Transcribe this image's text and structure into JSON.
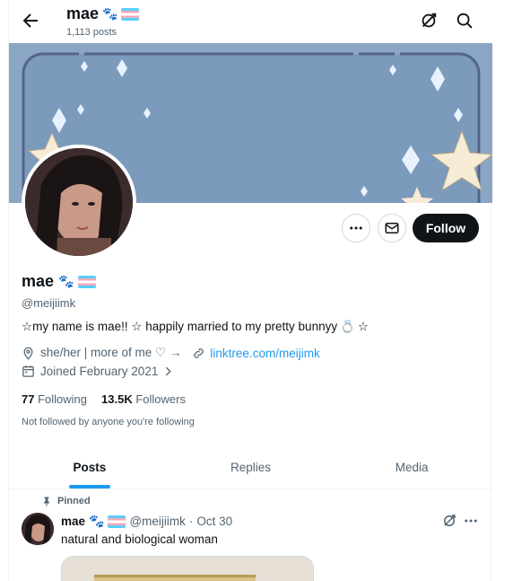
{
  "header": {
    "display_name": "mae",
    "post_count": "1,113 posts",
    "paw_emoji": "🐾"
  },
  "profile": {
    "display_name": "mae",
    "handle": "@meijiimk",
    "bio": "☆my name is mae!! ☆ happily married to my pretty bunnyy",
    "bio_end": "☆",
    "ring_emoji": "💍",
    "location": "she/her | more of me ♡ →",
    "link_text": "linktree.com/meijimk",
    "joined": "Joined February 2021",
    "following_count": "77",
    "following_label": "Following",
    "followers_count": "13.5K",
    "followers_label": "Followers",
    "not_followed": "Not followed by anyone you're following",
    "follow_label": "Follow"
  },
  "tabs": [
    {
      "label": "Posts"
    },
    {
      "label": "Replies"
    },
    {
      "label": "Media"
    }
  ],
  "post": {
    "pinned_label": "Pinned",
    "author": "mae",
    "handle": "@meijiimk",
    "separator": "·",
    "date": "Oct 30",
    "text": "natural and biological woman"
  },
  "colors": {
    "accent": "#1d9bf0",
    "banner": "#7f9dbd",
    "follow_button": "#0f1419"
  },
  "icons": [
    "back-arrow-icon",
    "grok-icon",
    "search-icon",
    "more-icon",
    "message-icon",
    "location-icon",
    "link-icon",
    "calendar-icon",
    "chevron-right-icon",
    "pin-icon"
  ]
}
